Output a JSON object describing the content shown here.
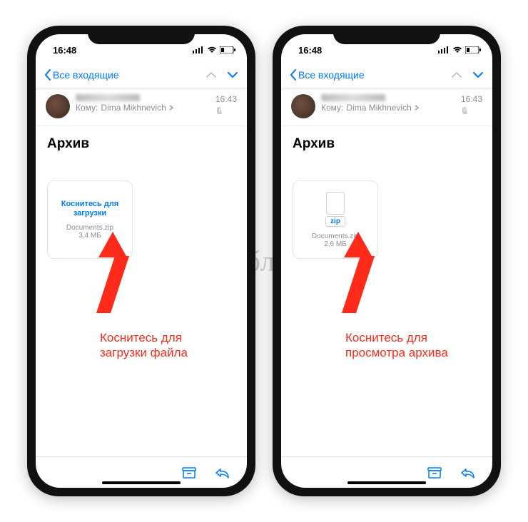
{
  "watermark": "Я ́блык",
  "phones": [
    {
      "status_time": "16:48",
      "back_label": "Все входящие",
      "msg_time": "16:43",
      "to_prefix": "Кому:",
      "to_name": "Dima Mikhnevich",
      "subject": "Архив",
      "attachment": {
        "mode": "tap",
        "tap_line1": "Коснитесь для",
        "tap_line2": "загрузки",
        "filename": "Documents.zip",
        "filesize": "3,4 МБ"
      },
      "annotation_line1": "Коснитесь для",
      "annotation_line2": "загрузки файла"
    },
    {
      "status_time": "16:48",
      "back_label": "Все входящие",
      "msg_time": "16:43",
      "to_prefix": "Кому:",
      "to_name": "Dima Mikhnevich",
      "subject": "Архив",
      "attachment": {
        "mode": "icon",
        "badge": "zip",
        "filename": "Documents.zip",
        "filesize": "2,6 МБ"
      },
      "annotation_line1": "Коснитесь для",
      "annotation_line2": "просмотра архива"
    }
  ]
}
